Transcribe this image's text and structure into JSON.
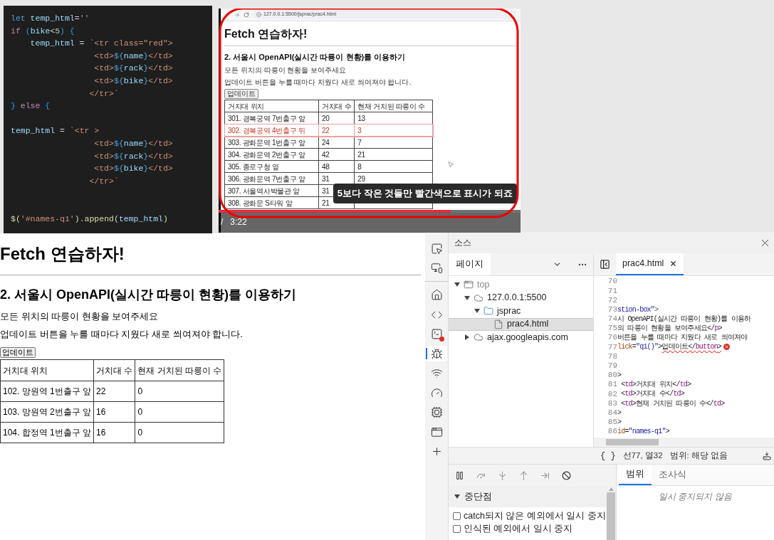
{
  "code_editor": {
    "lines": [
      {
        "kind": "code",
        "tokens": [
          {
            "text": "let",
            "kind": "decl"
          },
          {
            "text": " temp_html",
            "kind": "var"
          },
          {
            "text": "=",
            "kind": "op"
          },
          {
            "text": "''",
            "kind": "str"
          }
        ]
      },
      {
        "kind": "code",
        "tokens": [
          {
            "text": "if",
            "kind": "ctrl"
          },
          {
            "text": " (",
            "kind": "bracket"
          },
          {
            "text": "bike",
            "kind": "var"
          },
          {
            "text": "<",
            "kind": "op"
          },
          {
            "text": "5",
            "kind": "num"
          },
          {
            "text": ") {",
            "kind": "bracket"
          }
        ]
      },
      {
        "kind": "code",
        "tokens": [
          {
            "text": "    temp_html",
            "kind": "var"
          },
          {
            "text": " = ",
            "kind": "op"
          },
          {
            "text": "`<tr class=\"red\">",
            "kind": "str"
          }
        ]
      },
      {
        "kind": "code",
        "tokens": [
          {
            "text": "                 <td>",
            "kind": "str"
          },
          {
            "text": "${",
            "kind": "decl"
          },
          {
            "text": "name",
            "kind": "var"
          },
          {
            "text": "}",
            "kind": "decl"
          },
          {
            "text": "</td>",
            "kind": "str"
          }
        ]
      },
      {
        "kind": "code",
        "tokens": [
          {
            "text": "                 <td>",
            "kind": "str"
          },
          {
            "text": "${",
            "kind": "decl"
          },
          {
            "text": "rack",
            "kind": "var"
          },
          {
            "text": "}",
            "kind": "decl"
          },
          {
            "text": "</td>",
            "kind": "str"
          }
        ]
      },
      {
        "kind": "code",
        "tokens": [
          {
            "text": "                 <td>",
            "kind": "str"
          },
          {
            "text": "${",
            "kind": "decl"
          },
          {
            "text": "bike",
            "kind": "var"
          },
          {
            "text": "}",
            "kind": "decl"
          },
          {
            "text": "</td>",
            "kind": "str"
          }
        ]
      },
      {
        "kind": "code",
        "tokens": [
          {
            "text": "                </tr>`",
            "kind": "str"
          }
        ]
      },
      {
        "kind": "code",
        "tokens": [
          {
            "text": "} ",
            "kind": "bracket"
          },
          {
            "text": "else",
            "kind": "ctrl"
          },
          {
            "text": " {",
            "kind": "bracket"
          }
        ]
      },
      {
        "kind": "blank"
      },
      {
        "kind": "code",
        "tokens": [
          {
            "text": "temp_html",
            "kind": "var"
          },
          {
            "text": " = ",
            "kind": "op"
          },
          {
            "text": "`<tr >",
            "kind": "str"
          }
        ]
      },
      {
        "kind": "code",
        "tokens": [
          {
            "text": "                 <td>",
            "kind": "str"
          },
          {
            "text": "${",
            "kind": "decl"
          },
          {
            "text": "name",
            "kind": "var"
          },
          {
            "text": "}",
            "kind": "decl"
          },
          {
            "text": "</td>",
            "kind": "str"
          }
        ]
      },
      {
        "kind": "code",
        "tokens": [
          {
            "text": "                 <td>",
            "kind": "str"
          },
          {
            "text": "${",
            "kind": "decl"
          },
          {
            "text": "rack",
            "kind": "var"
          },
          {
            "text": "}",
            "kind": "decl"
          },
          {
            "text": "</td>",
            "kind": "str"
          }
        ]
      },
      {
        "kind": "code",
        "tokens": [
          {
            "text": "                 <td>",
            "kind": "str"
          },
          {
            "text": "${",
            "kind": "decl"
          },
          {
            "text": "bike",
            "kind": "var"
          },
          {
            "text": "}",
            "kind": "decl"
          },
          {
            "text": "</td>",
            "kind": "str"
          }
        ]
      },
      {
        "kind": "code",
        "tokens": [
          {
            "text": "                </tr>`",
            "kind": "str"
          }
        ]
      },
      {
        "kind": "blank"
      },
      {
        "kind": "blank"
      },
      {
        "kind": "code",
        "tokens": [
          {
            "text": "$(",
            "kind": "fn"
          },
          {
            "text": "'#names-q1'",
            "kind": "str"
          },
          {
            "text": ").",
            "kind": "fn"
          },
          {
            "text": "append",
            "kind": "fn"
          },
          {
            "text": "(",
            "kind": "fn"
          },
          {
            "text": "temp_html",
            "kind": "var"
          },
          {
            "text": ")",
            "kind": "fn"
          }
        ]
      }
    ]
  },
  "video": {
    "url": "127.0.0.1:5500/jsprac/prac4.html",
    "heading": "Fetch 연습하자!",
    "subheading": "2. 서울시 OpenAPI(실시간 따릉이 현황)를 이용하기",
    "paragraphs": [
      "모든 위치의 따릉이 현황을 보여주세요",
      "업데이트 버튼을 누를 때마다 지웠다 새로 씌여져야 합니다."
    ],
    "button": "업데이트",
    "table": {
      "columns": [
        "거치대 위치",
        "거치대 수",
        "현재 거치된 따릉이 수"
      ],
      "rows": [
        {
          "name": "301. 경복궁역 7번출구 앞",
          "rack": "20",
          "bike": "13",
          "red": false
        },
        {
          "name": "302. 경복궁역 4번출구 뒤",
          "rack": "22",
          "bike": "3",
          "red": true
        },
        {
          "name": "303. 광화문역 1번출구 앞",
          "rack": "24",
          "bike": "7",
          "red": false
        },
        {
          "name": "304. 광화문역 2번출구 앞",
          "rack": "42",
          "bike": "21",
          "red": false
        },
        {
          "name": "305. 종로구청 옆",
          "rack": "48",
          "bike": "8",
          "red": false
        },
        {
          "name": "306. 광화문역 7번출구 앞",
          "rack": "31",
          "bike": "29",
          "red": false
        },
        {
          "name": "307. 서울역사박물관 앞",
          "rack": "31",
          "red": false
        },
        {
          "name": "308. 광화문 S타워 앞",
          "rack": "21",
          "red": false
        }
      ]
    },
    "subtitle": "5보다 작은 것들만 빨간색으로 표시가 되죠",
    "progress": {
      "level": 0.77
    },
    "time_separator": "/",
    "duration": "3:22"
  },
  "page": {
    "heading": "Fetch 연습하자!",
    "subheading": "2. 서울시 OpenAPI(실시간 따릉이 현황)를 이용하기",
    "paragraphs": [
      "모든 위치의 따릉이 현황을 보여주세요",
      "업데이트 버튼을 누를 때마다 지웠다 새로 씌여져야 합니다."
    ],
    "button": "업데이트",
    "table": {
      "columns": [
        "거치대 위치",
        "거치대 수",
        "현재 거치된 따릉이 수"
      ],
      "rows": [
        [
          "102. 망원역 1번출구 앞",
          "22",
          "0"
        ],
        [
          "103. 망원역 2번출구 앞",
          "16",
          "0"
        ],
        [
          "104. 합정역 1번출구 앞",
          "16",
          "0"
        ]
      ]
    }
  },
  "devtools": {
    "activity_bar": [
      {
        "selected": false
      },
      {
        "selected": false
      },
      {
        "selected": false
      },
      {
        "selected": false
      },
      {
        "selected": false
      },
      {
        "selected": true
      },
      {
        "selected": false
      },
      {
        "selected": false
      },
      {
        "selected": false
      },
      {
        "selected": false
      },
      {
        "selected": false
      }
    ],
    "title": "소스",
    "navigator_tab": "페이지",
    "tree": [
      {
        "label": "top",
        "kind": "frame",
        "expanded": true,
        "selected": false,
        "children": [
          {
            "label": "127.0.0.1:5500",
            "kind": "origin",
            "expanded": true,
            "selected": false,
            "children": [
              {
                "label": "jsprac",
                "kind": "folder",
                "expanded": true,
                "selected": false,
                "children": [
                  {
                    "label": "prac4.html",
                    "kind": "file",
                    "selected": true
                  }
                ]
              }
            ]
          },
          {
            "label": "ajax.googleapis.com",
            "kind": "origin",
            "expanded": false,
            "selected": false
          }
        ]
      }
    ],
    "editor_tab": "prac4.html",
    "source_lines": [
      {
        "number": "70"
      },
      {
        "number": "71"
      },
      {
        "number": "72"
      },
      {
        "number": "73",
        "tokens": [
          {
            "text": "stion-box\"",
            "kind": "value"
          },
          {
            "text": ">",
            "kind": "punct"
          }
        ]
      },
      {
        "number": "74",
        "tokens": [
          {
            "text": "시 OpenAPI(실시간 따릉이 현황)를 이용하",
            "kind": "text"
          }
        ]
      },
      {
        "number": "75",
        "tokens": [
          {
            "text": "의 따릉이 현황을 보여주세요</",
            "kind": "text"
          },
          {
            "text": "p",
            "kind": "tag"
          },
          {
            "text": ">",
            "kind": "text"
          }
        ]
      },
      {
        "number": "76",
        "tokens": [
          {
            "text": "버튼을 누를 때마다 지웠다 새로 씌여져야",
            "kind": "text"
          }
        ]
      },
      {
        "number": "77",
        "error": true,
        "tokens": [
          {
            "text": "lick",
            "kind": "attr",
            "squiggle": false
          },
          {
            "text": "=",
            "kind": "text",
            "squiggle": false
          },
          {
            "text": "\"q1()\"",
            "kind": "value",
            "squiggle": false
          },
          {
            "text": ">",
            "kind": "text",
            "squiggle": false
          },
          {
            "text": "업데이트</",
            "kind": "text",
            "squiggle": true
          },
          {
            "text": "button",
            "kind": "tag",
            "squiggle": true
          },
          {
            "text": ">",
            "kind": "text",
            "squiggle": true
          }
        ]
      },
      {
        "number": "78"
      },
      {
        "number": "79"
      },
      {
        "number": "80",
        "tokens": [
          {
            "text": ">",
            "kind": "text"
          }
        ]
      },
      {
        "number": "81",
        "tokens": [
          {
            "text": " <",
            "kind": "text"
          },
          {
            "text": "td",
            "kind": "tag"
          },
          {
            "text": ">거치대 위치</",
            "kind": "text"
          },
          {
            "text": "td",
            "kind": "tag"
          },
          {
            "text": ">",
            "kind": "text"
          }
        ]
      },
      {
        "number": "82",
        "tokens": [
          {
            "text": " <",
            "kind": "text"
          },
          {
            "text": "td",
            "kind": "tag"
          },
          {
            "text": ">거치대 수</",
            "kind": "text"
          },
          {
            "text": "td",
            "kind": "tag"
          },
          {
            "text": ">",
            "kind": "text"
          }
        ]
      },
      {
        "number": "83",
        "tokens": [
          {
            "text": " <",
            "kind": "text"
          },
          {
            "text": "td",
            "kind": "tag"
          },
          {
            "text": ">현재 거치된 따릉이 수</",
            "kind": "text"
          },
          {
            "text": "td",
            "kind": "tag"
          },
          {
            "text": ">",
            "kind": "text"
          }
        ]
      },
      {
        "number": "84",
        "tokens": [
          {
            "text": ">",
            "kind": "text"
          }
        ]
      },
      {
        "number": "85",
        "tokens": [
          {
            "text": ">",
            "kind": "text"
          }
        ]
      },
      {
        "number": "86",
        "tokens": [
          {
            "text": "id",
            "kind": "attr"
          },
          {
            "text": "=",
            "kind": "text"
          },
          {
            "text": "\"names-q1\"",
            "kind": "value"
          },
          {
            "text": ">",
            "kind": "text"
          }
        ]
      }
    ],
    "status": {
      "format": "{ }",
      "position": "선77, 열32",
      "scope": "범위: 해당 없음"
    },
    "breakpoints": {
      "title": "중단점",
      "expanded": true,
      "options": [
        {
          "label": "catch되지 않은 예외에서 일시 중지",
          "checked": false
        },
        {
          "label": "인식된 예외에서 일시 중지",
          "checked": false
        }
      ]
    },
    "side_tabs": [
      {
        "label": "범위",
        "selected": true
      },
      {
        "label": "조사식",
        "selected": false
      }
    ],
    "side_message": "일시 중지되지 않음"
  }
}
